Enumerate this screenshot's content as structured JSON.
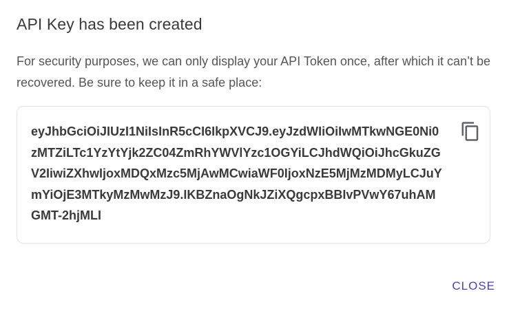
{
  "dialog": {
    "title": "API Key has been created",
    "description": "For security purposes, we can only display your API Token once, after which it can’t be recovered. Be sure to keep it in a safe place:",
    "token": "eyJhbGciOiJIUzI1NiIsInR5cCI6IkpXVCJ9.eyJzdWIiOiIwMTkwNGE0Ni0zMTZiLTc1YzYtYjk2ZC04ZmRhYWVlYzc1OGYiLCJhdWQiOiJhcGkuZGV2IiwiZXhwIjoxMDQxMzc5MjAwMCwiaWF0IjoxNzE5MjMzMDMyLCJuYmYiOjE3MTkyMzMwMzJ9.IKBZnaOgNkJZiXQgcpxBBIvPVwY67uhAMGMT-2hjMLI",
    "copy_icon": "copy-icon",
    "close_label": "CLOSE"
  },
  "colors": {
    "accent": "#4b3fbf",
    "title_text": "#3a3a3a",
    "body_text": "#555555",
    "border": "#e3e3e3"
  }
}
